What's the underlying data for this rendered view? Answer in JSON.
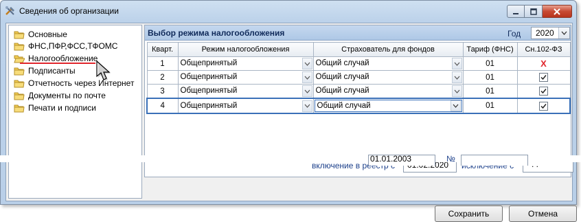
{
  "window": {
    "title": "Сведения об организации"
  },
  "sidebar": {
    "items": [
      {
        "label": "Основные"
      },
      {
        "label": "ФНС,ПФР,ФСС,ТФОМС"
      },
      {
        "label": "Налогообложение",
        "selected": true
      },
      {
        "label": "Подписанты"
      },
      {
        "label": "Отчетность через Интернет"
      },
      {
        "label": "Документы по почте"
      },
      {
        "label": "Печати и подписи"
      }
    ]
  },
  "tax_section": {
    "title": "Выбор режима налогообложения",
    "year_label": "Год",
    "year_value": "2020",
    "columns": [
      "Кварт.",
      "Режим налогообложения",
      "Страхователь для фондов",
      "Тариф (ФНС)",
      "Сн.102-ФЗ"
    ],
    "rows": [
      {
        "quarter": "1",
        "regime": "Общепринятый",
        "insurer": "Общий случай",
        "tariff": "01",
        "sn102": "X"
      },
      {
        "quarter": "2",
        "regime": "Общепринятый",
        "insurer": "Общий случай",
        "tariff": "01",
        "sn102": "checked"
      },
      {
        "quarter": "3",
        "regime": "Общепринятый",
        "insurer": "Общий случай",
        "tariff": "01",
        "sn102": "checked"
      },
      {
        "quarter": "4",
        "regime": "Общепринятый",
        "insurer": "Общий случай",
        "tariff": "01",
        "sn102": "checked"
      }
    ]
  },
  "registry": {
    "inclusion_label": "включение в реестр с",
    "inclusion_value": "01.02.2020",
    "exclusion_label": "исключение с",
    "exclusion_value": ". ."
  },
  "partial_row": {
    "date_value": "01.01.2003",
    "number_label": "№"
  },
  "buttons": {
    "save": "Сохранить",
    "cancel": "Отмена"
  },
  "colors": {
    "header_bg": "#aec8e6",
    "accent_red": "#e0252b",
    "label_blue": "#1b3f8a"
  }
}
